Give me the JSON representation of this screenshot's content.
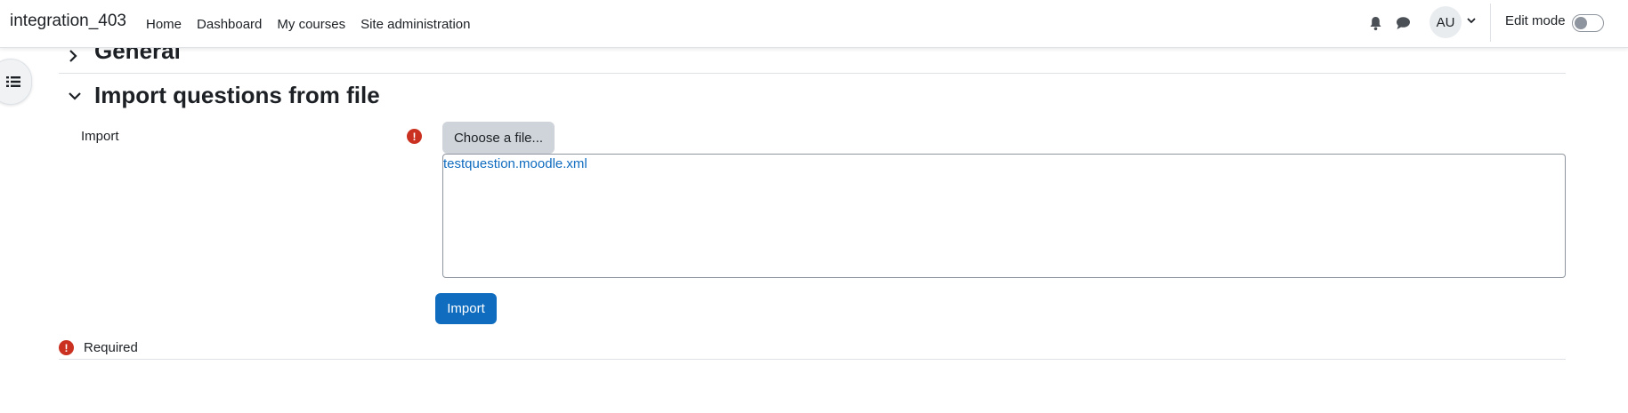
{
  "site_name": "integration_403",
  "nav": {
    "items": [
      "Home",
      "Dashboard",
      "My courses",
      "Site administration"
    ]
  },
  "user": {
    "initials": "AU",
    "edit_mode_label": "Edit mode",
    "edit_mode_on": false
  },
  "icons": {
    "notifications": "bell-icon",
    "messages": "chat-icon",
    "drawer": "list-icon",
    "required": "exclamation-circle-icon"
  },
  "form": {
    "general_section_title": "General",
    "import_section_title": "Import questions from file",
    "import_label": "Import",
    "choose_file_label": "Choose a file...",
    "selected_file": "testquestion.moodle.xml",
    "import_button_label": "Import",
    "required_note": "Required"
  },
  "colors": {
    "primary": "#0f6cbf",
    "required_icon": "#ca3120",
    "secondary_button": "#ced4da"
  }
}
